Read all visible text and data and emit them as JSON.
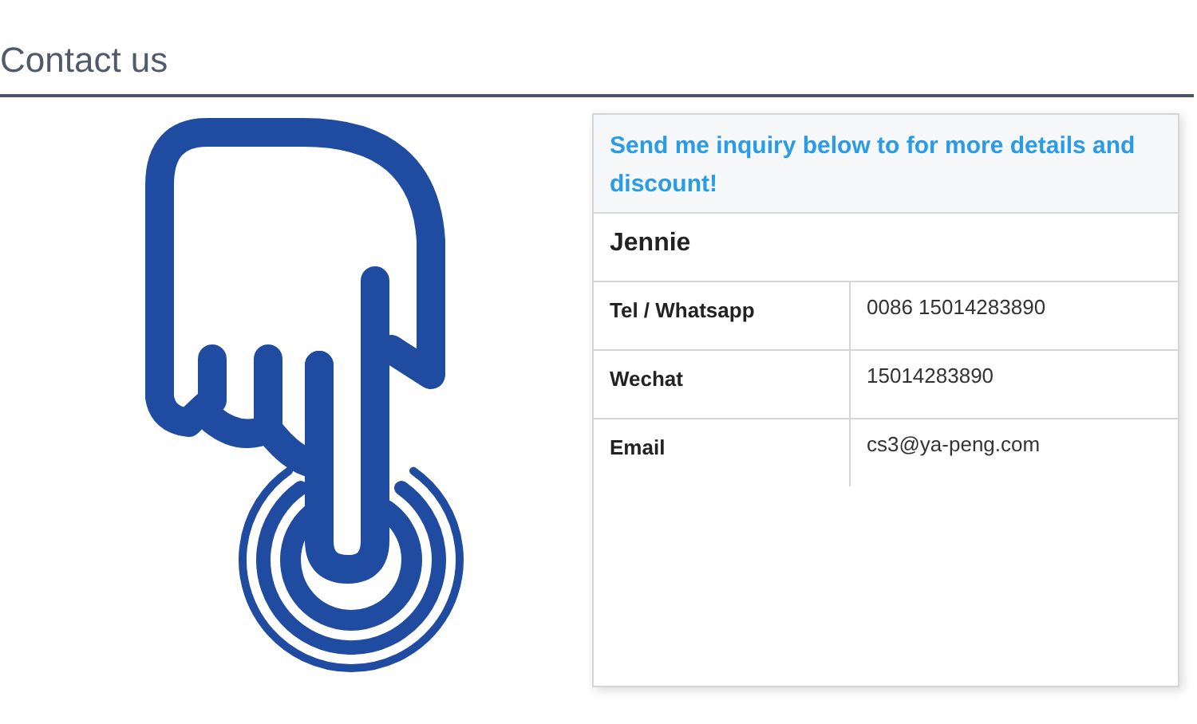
{
  "heading": "Contact us",
  "card": {
    "title": "Send me inquiry below to for more details and discount!",
    "name": "Jennie",
    "rows": [
      {
        "label": "Tel / Whatsapp",
        "value": "0086 15014283890"
      },
      {
        "label": "Wechat",
        "value": "15014283890"
      },
      {
        "label": "Email",
        "value": "cs3@ya-peng.com"
      }
    ]
  }
}
